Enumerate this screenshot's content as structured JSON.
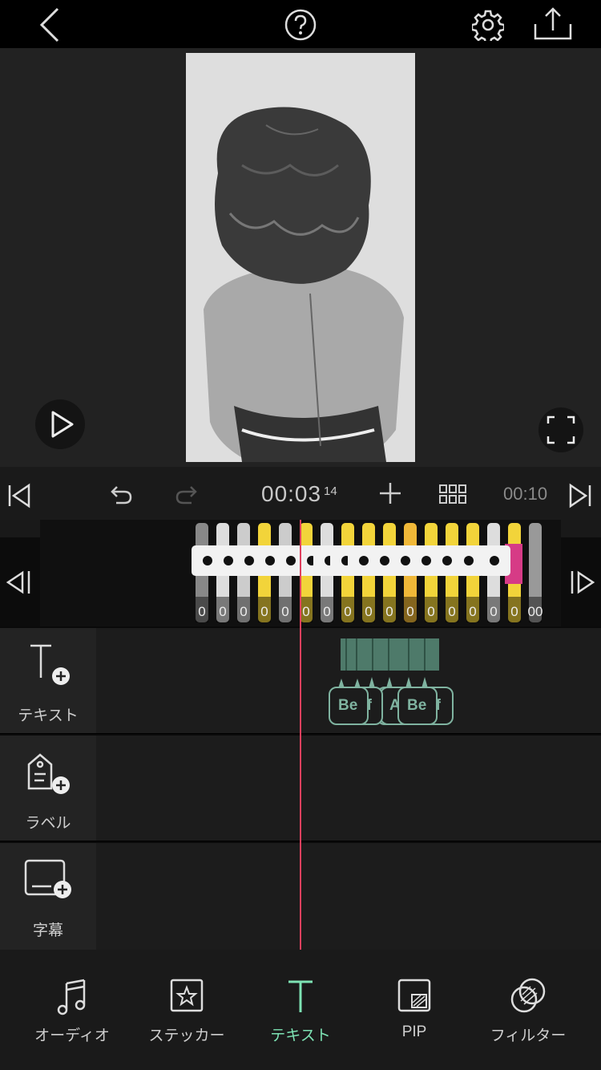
{
  "top_bar": {
    "back_icon": "chevron-left-icon",
    "help_icon": "question-circle-icon",
    "settings_icon": "gear-icon",
    "share_icon": "share-upload-icon"
  },
  "preview": {
    "play_icon": "play-icon",
    "fullscreen_icon": "expand-icon"
  },
  "toolbar": {
    "current_time": "00:03",
    "current_frames": "14",
    "total_time": "00:10"
  },
  "video_track": {
    "clip_time_labels": [
      "0",
      "0",
      "0",
      "0",
      "0",
      "0",
      "0",
      "0",
      "0",
      "0",
      "0",
      "0",
      "0",
      "0",
      "0",
      "0",
      "00"
    ]
  },
  "lanes": [
    {
      "label": "テキスト",
      "icon": "text-add-icon"
    },
    {
      "label": "ラベル",
      "icon": "label-add-icon"
    },
    {
      "label": "字幕",
      "icon": "subtitle-add-icon"
    }
  ],
  "text_clips": [
    "Be",
    "Be",
    "f",
    "A",
    "Be",
    "f"
  ],
  "bottom_nav": [
    {
      "label": "オーディオ",
      "icon": "music-note-icon",
      "active": false
    },
    {
      "label": "ステッカー",
      "icon": "sticker-icon",
      "active": false
    },
    {
      "label": "テキスト",
      "icon": "text-icon",
      "active": true
    },
    {
      "label": "PIP",
      "icon": "pip-icon",
      "active": false
    },
    {
      "label": "フィルター",
      "icon": "filter-icon",
      "active": false
    }
  ],
  "colors": {
    "accent": "#7de3b4",
    "playhead": "#e0405e",
    "text_clip": "#4e7a6a",
    "clip_yellow": "#f2d43a"
  }
}
